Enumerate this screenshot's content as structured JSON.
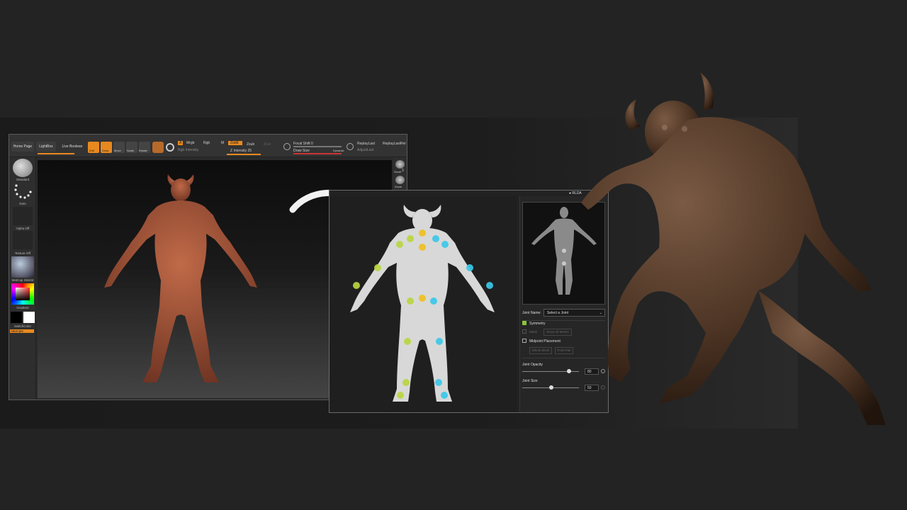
{
  "zbrush": {
    "top_tabs": [
      "Home Page",
      "LightBox",
      "Live Boolean"
    ],
    "tools": [
      "Edit",
      "Draw",
      "Move",
      "Scale",
      "Rotate"
    ],
    "mrgb": "Mrgb",
    "rgb": "Rgb",
    "m": "M",
    "zadd": "Zadd",
    "zsub": "Zsub",
    "zcut": "Zcut",
    "a_label": "A",
    "rgb_intensity": "Rgb Intensity",
    "z_intensity": "Z Intensity 25",
    "focal_shift": "Focal Shift 0",
    "draw_size": "Draw Size",
    "dynamic": "Dynamic",
    "replay_last": "ReplayLast",
    "replay_last_rel": "ReplayLastRel",
    "adjust_last": "AdjustLast",
    "left_labels": [
      "Standard",
      "Dots",
      "Alpha Off",
      "Texture Off",
      "MatCap Skin04",
      "Gradient",
      "SwitchColor",
      "Alternate"
    ],
    "right_labels": [
      "Scroll",
      "Zoom"
    ],
    "right_value": "3",
    "colors": {
      "accent": "#e8891f",
      "sculpt": "#a05a3e"
    }
  },
  "joint_tool": {
    "brand": "RLDA",
    "joint_name_label": "Joint Name:",
    "joint_select_value": "Select a Joint",
    "symmetry_label": "Symmetry",
    "mesh_label": "Mesh",
    "show_all_meshs": "Show All Meshs",
    "midpoint_label": "Midpoint Placement",
    "whole_mesh": "Whole Mesh",
    "point_pair": "Point Pair",
    "joint_opacity_label": "Joint Opacity",
    "joint_opacity_value": "80",
    "joint_opacity_level": 0.8,
    "joint_size_label": "Joint Size",
    "joint_size_value": "50",
    "joint_size_level": 0.5,
    "colors": {
      "check": "#8ac43a",
      "dot_yellow": "#f0c020",
      "dot_green": "#b9d640",
      "dot_cyan": "#3bc8e8"
    }
  }
}
